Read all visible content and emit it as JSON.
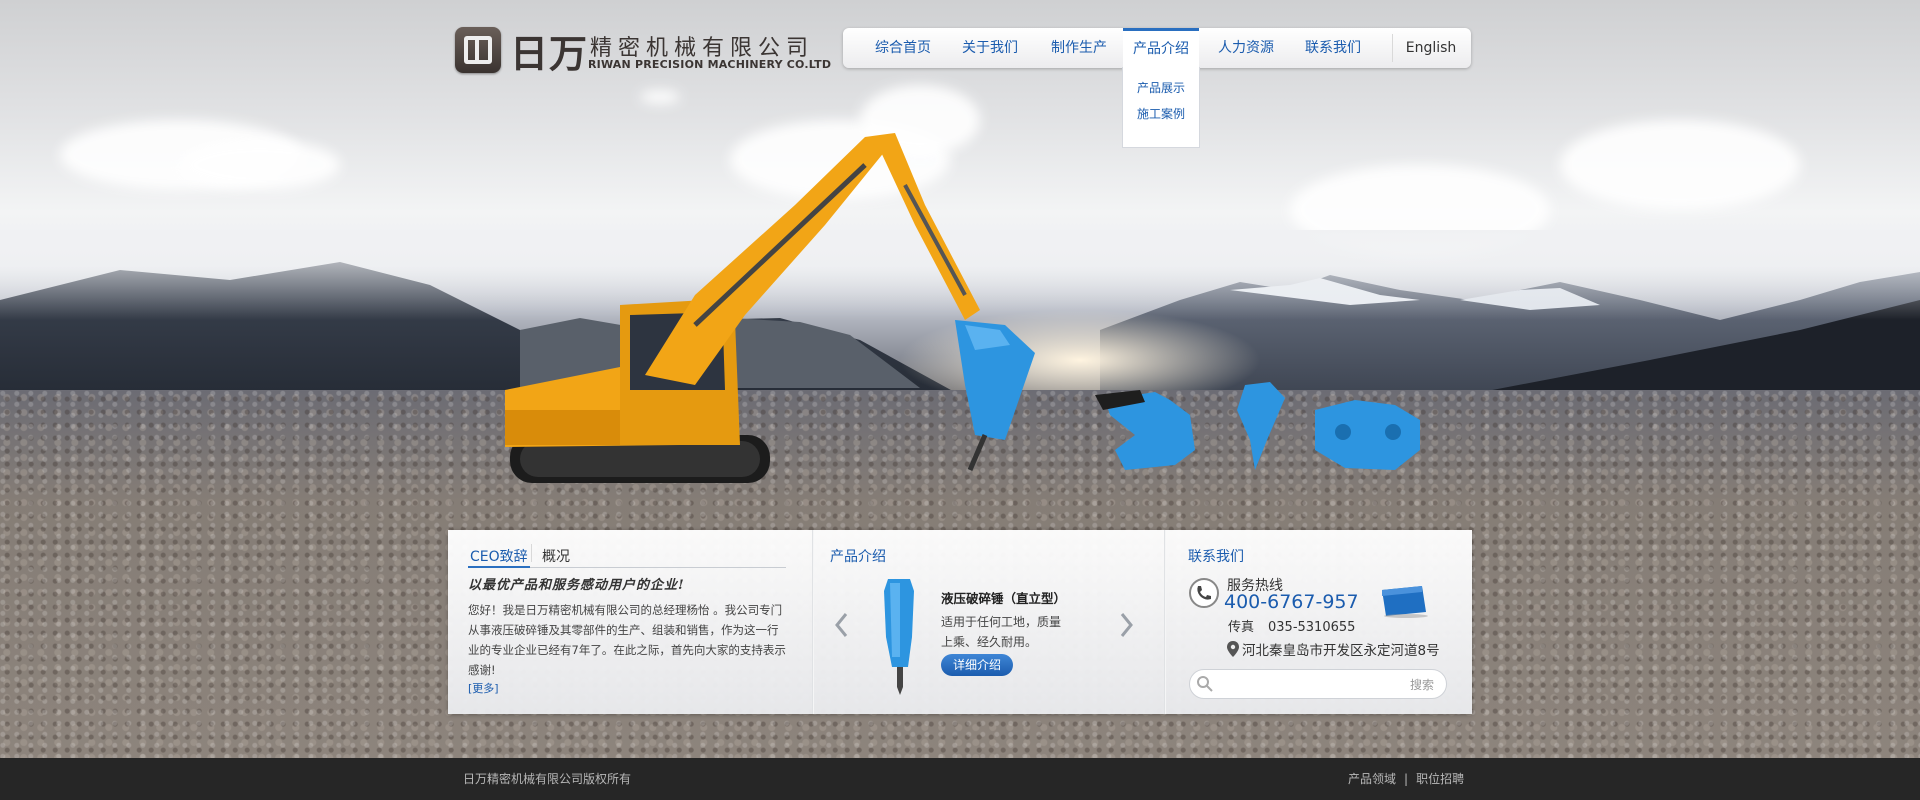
{
  "company": {
    "name_cn": "日万",
    "name_cn_rest": "精密机械有限公司",
    "name_en": "RIWAN PRECISION MACHINERY CO.LTD"
  },
  "nav": {
    "items": [
      "综合首页",
      "关于我们",
      "制作生产",
      "产品介绍",
      "人力资源",
      "联系我们"
    ],
    "active": "产品介绍",
    "english": "English",
    "dropdown": [
      "产品展示",
      "施工案例"
    ]
  },
  "ceo": {
    "tab_active": "CEO致辞",
    "tab_other": "概况",
    "slogan": "以最优产品和服务感动用户的企业!",
    "text": "您好！我是日万精密机械有限公司的总经理杨怡 。我公司专门从事液压破碎锤及其零部件的生产、组装和销售，作为这一行业的专业企业已经有7年了。在此之际，首先向大家的支持表示感谢!",
    "more": "[更多]"
  },
  "product": {
    "title": "产品介绍",
    "name": "液压破碎锤（直立型）",
    "desc": "适用于任何工地，质量上乘、经久耐用。",
    "button": "详细介绍",
    "prev_icon": "chevron-left-icon",
    "next_icon": "chevron-right-icon"
  },
  "contact": {
    "title": "联系我们",
    "hotline_label": "服务热线",
    "hotline": "400-6767-957",
    "fax_label": "传真",
    "fax": "035-5310655",
    "address": "河北秦皇岛市开发区永定河道8号",
    "search_placeholder": "",
    "search_button": "搜索"
  },
  "footer": {
    "copyright": "日万精密机械有限公司版权所有",
    "links": [
      "产品领域",
      "职位招聘"
    ],
    "separator": "|"
  },
  "colors": {
    "accent": "#1b5cae",
    "footer_bg": "#262626",
    "excavator": "#f2a516",
    "attachment": "#2d95e0"
  }
}
